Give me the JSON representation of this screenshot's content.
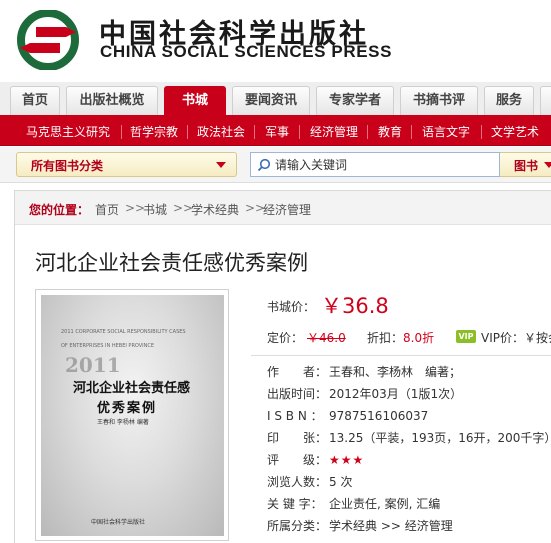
{
  "brand": {
    "name_cn": "中国社会科学出版社",
    "name_en": "CHINA SOCIAL SCIENCES PRESS",
    "colors": {
      "red": "#c8001a",
      "green": "#1d6b3a"
    }
  },
  "tabs": [
    {
      "label": "首页",
      "active": false
    },
    {
      "label": "出版社概览",
      "active": false
    },
    {
      "label": "书城",
      "active": true
    },
    {
      "label": "要闻资讯",
      "active": false
    },
    {
      "label": "专家学者",
      "active": false
    },
    {
      "label": "书摘书评",
      "active": false
    },
    {
      "label": "服务",
      "active": false
    }
  ],
  "categories": [
    "马克思主义研究",
    "哲学宗教",
    "政法社会",
    "军事",
    "经济管理",
    "教育",
    "语言文字",
    "文学艺术"
  ],
  "search": {
    "all_categories": "所有图书分类",
    "placeholder": "请输入关键词",
    "scope": "图书"
  },
  "breadcrumb": {
    "lead": "您的位置：",
    "items": [
      "首页",
      "书城",
      "学术经典",
      "经济管理"
    ],
    "separator": ">>"
  },
  "book": {
    "title": "河北企业社会责任感优秀案例",
    "cover": {
      "year": "2011",
      "title_line1": "河北企业社会责任感",
      "title_line2": "优秀案例",
      "authors": "王春和   李杨林   编著",
      "en_line1": "2011 CORPORATE SOCIAL RESPONSIBILITY CASES",
      "en_line2": "OF ENTERPRISES IN HEBEI PROVINCE",
      "publisher": "中国社会科学出版社"
    },
    "price": {
      "store_label": "书城价：",
      "store_value": "￥36.8",
      "list_label": "定价：",
      "list_value": "￥46.0",
      "discount_label": "折扣：",
      "discount_value": "8.0折",
      "vip_badge": "VIP",
      "vip_label": "VIP价：￥按会"
    },
    "details": [
      {
        "label": "作　　者：",
        "value": "王春和、李杨林　编著；"
      },
      {
        "label": "出版时间：",
        "value": "2012年03月（1版1次）"
      },
      {
        "label": "I S B N ：",
        "value": "9787516106037"
      },
      {
        "label": "印　　张：",
        "value": "13.25（平装，193页，16开，200千字）"
      },
      {
        "label": "评　　级：",
        "value": "★★★"
      },
      {
        "label": "浏览人数：",
        "value": "5 次"
      },
      {
        "label": "关 键 字：",
        "value": "企业责任, 案例, 汇编"
      },
      {
        "label": "所属分类：",
        "value": "学术经典 >> 经济管理"
      }
    ]
  }
}
